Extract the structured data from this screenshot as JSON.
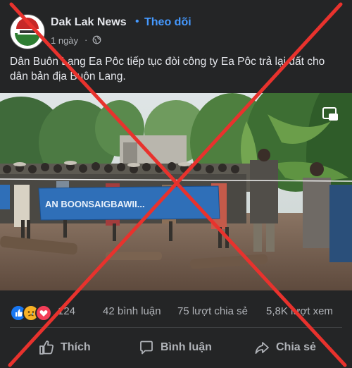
{
  "post": {
    "page_name": "Dak Lak News",
    "follow_label": "Theo dõi",
    "follow_dot": "•",
    "time": "1 ngày",
    "separator": "·",
    "text": "Dân Buôn Lang Ea Pôc tiếp tục đòi công ty Ea Pôc trả lại đất cho dân bản địa Buôn Lang.",
    "banner_text": "AN BOONSAIGBAWII..."
  },
  "stats": {
    "reaction_count": "124",
    "comments": "42 bình luận",
    "shares": "75 lượt chia sẻ",
    "views": "5,8K lượt xem"
  },
  "actions": {
    "like": "Thích",
    "comment": "Bình luận",
    "share": "Chia sẻ"
  },
  "colors": {
    "background": "#242526",
    "accent": "#4599ff",
    "cross": "#e8322d"
  }
}
